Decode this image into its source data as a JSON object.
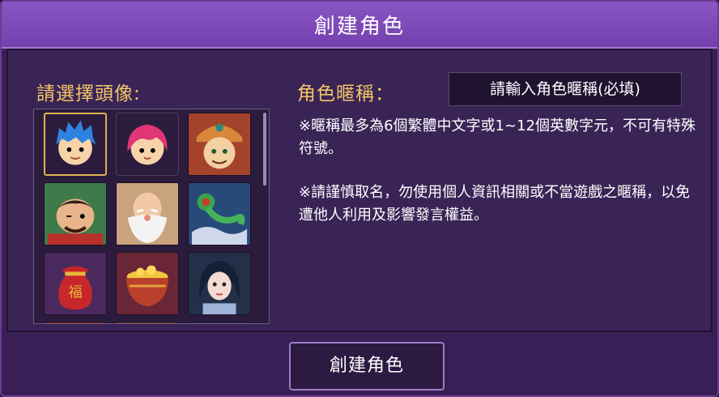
{
  "dialog": {
    "title": "創建角色"
  },
  "avatar_picker": {
    "label": "請選擇頭像:",
    "avatars": [
      {
        "name": "blue-hair-boy",
        "selected": true
      },
      {
        "name": "pink-hair-girl",
        "selected": false
      },
      {
        "name": "red-helmet-general",
        "selected": false
      },
      {
        "name": "winking-fat-man",
        "selected": false
      },
      {
        "name": "old-man-white-beard",
        "selected": false
      },
      {
        "name": "jade-ruyi",
        "selected": false
      },
      {
        "name": "fortune-bag",
        "selected": false
      },
      {
        "name": "gold-treasure-pot",
        "selected": false
      },
      {
        "name": "fairy-lady",
        "selected": false
      }
    ]
  },
  "nickname": {
    "label": "角色暱稱：",
    "placeholder": "請輸入角色暱稱(必填)"
  },
  "notes": {
    "rule1": "※暱稱最多為6個繁體中文字或1~12個英數字元，不可有特殊符號。",
    "rule2": "※請謹慎取名，勿使用個人資訊相關或不當遊戲之暱稱，以免遭他人利用及影響發言權益。"
  },
  "footer": {
    "create_button": "創建角色"
  },
  "colors": {
    "accent_gold": "#f3c566",
    "title_bar": "#8a56c4",
    "selected_border": "#d9b34e"
  }
}
